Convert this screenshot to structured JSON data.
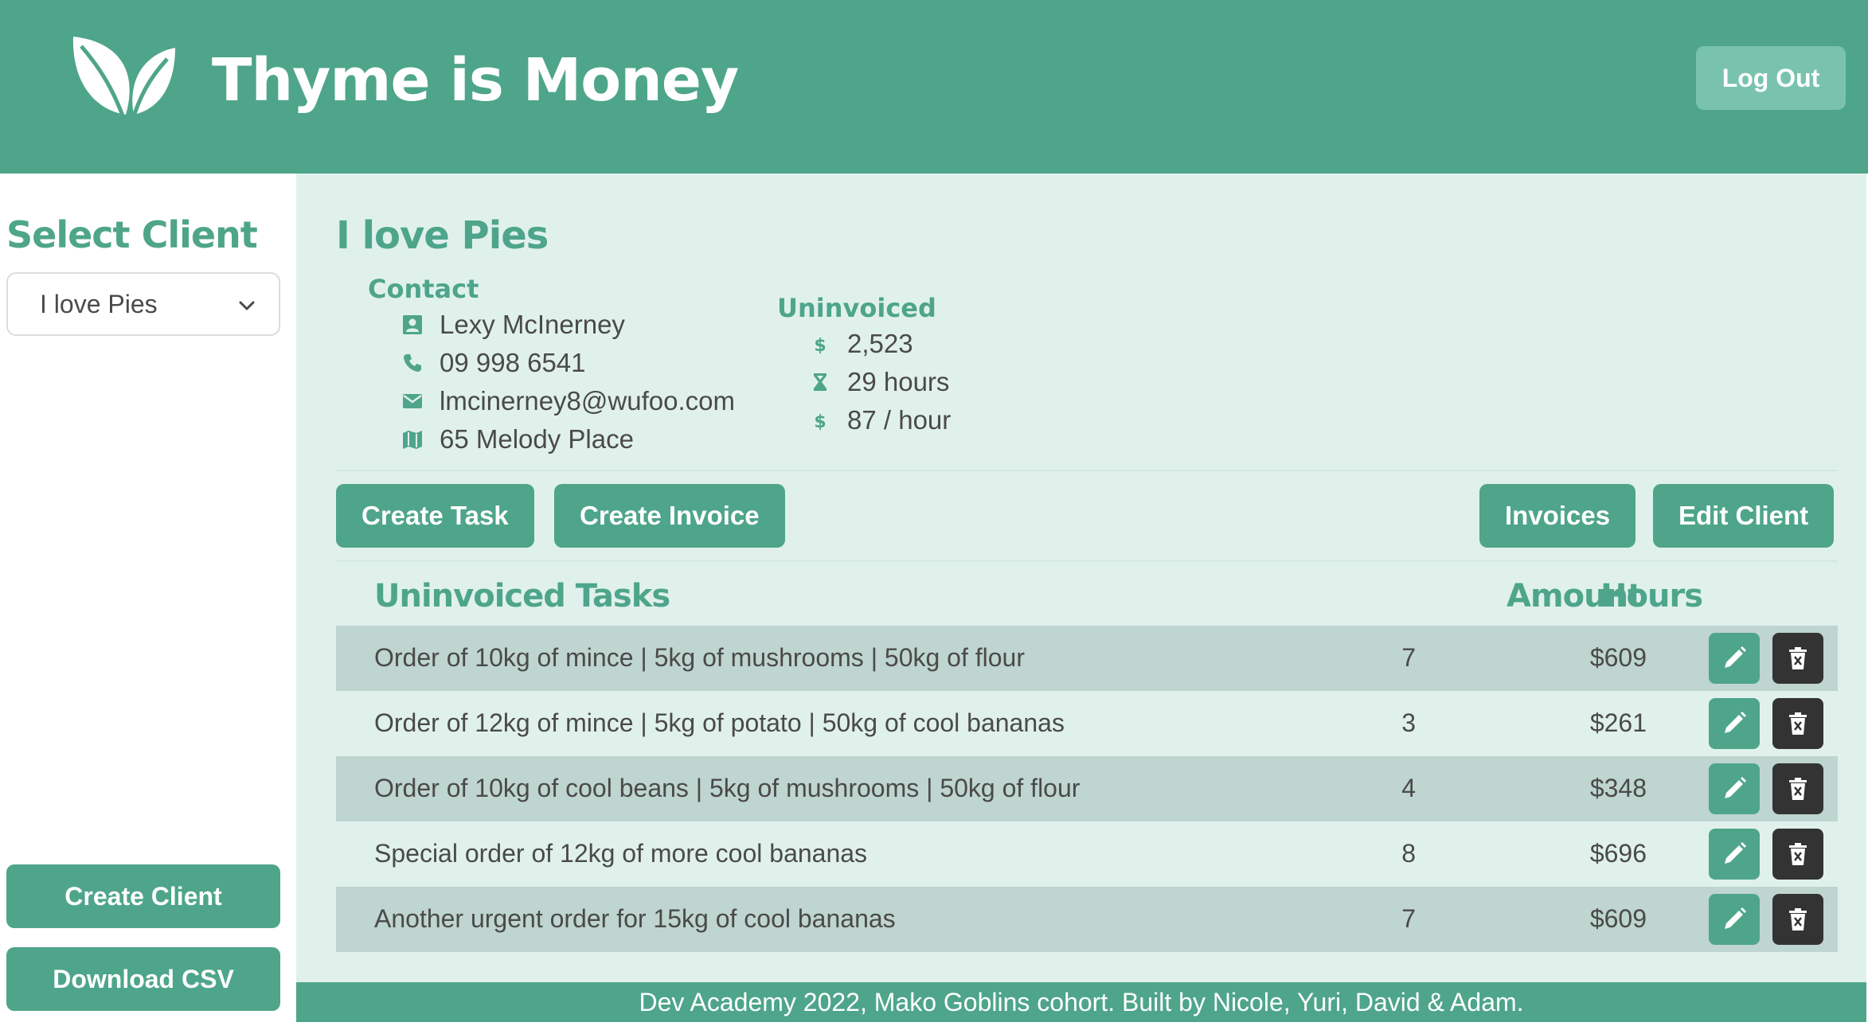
{
  "app": {
    "title": "Thyme is Money",
    "logout_label": "Log Out"
  },
  "colors": {
    "brand": "#4ea58a",
    "brand_light": "#79c3ad",
    "main_bg": "#e0f1ec",
    "row_shade": "#bfd5cf",
    "delete_bg": "#333333"
  },
  "sidebar": {
    "title": "Select Client",
    "selected_client": "I love Pies",
    "create_client_label": "Create Client",
    "download_csv_label": "Download CSV"
  },
  "client": {
    "name": "I love Pies",
    "contact": {
      "label": "Contact",
      "person": "Lexy McInerney",
      "phone": "09 998 6541",
      "email": "lmcinerney8@wufoo.com",
      "address": "65 Melody Place"
    },
    "uninvoiced": {
      "label": "Uninvoiced",
      "amount": "2,523",
      "hours": "29 hours",
      "rate": "87 / hour"
    }
  },
  "actions": {
    "create_task": "Create Task",
    "create_invoice": "Create Invoice",
    "invoices": "Invoices",
    "edit_client": "Edit Client"
  },
  "table": {
    "headers": {
      "task": "Uninvoiced Tasks",
      "hours": "Hours",
      "amount": "Amount"
    },
    "rows": [
      {
        "description": "Order of 10kg of mince | 5kg of mushrooms | 50kg of flour",
        "hours": "7",
        "amount": "$609"
      },
      {
        "description": "Order of 12kg of mince | 5kg of potato | 50kg of cool bananas",
        "hours": "3",
        "amount": "$261"
      },
      {
        "description": "Order of 10kg of cool beans | 5kg of mushrooms | 50kg of flour",
        "hours": "4",
        "amount": "$348"
      },
      {
        "description": "Special order of 12kg of more cool bananas",
        "hours": "8",
        "amount": "$696"
      },
      {
        "description": "Another urgent order for 15kg of cool bananas",
        "hours": "7",
        "amount": "$609"
      }
    ]
  },
  "icons": {
    "logo": "leaf-logo-icon",
    "person": "contact-card-icon",
    "phone": "phone-icon",
    "email": "envelope-icon",
    "address": "map-icon",
    "amount": "dollar-icon",
    "hours": "hourglass-icon",
    "rate": "dollar-icon",
    "edit": "pencil-icon",
    "delete": "trash-icon",
    "select": "chevron-down-icon"
  },
  "footer": {
    "text": "Dev Academy 2022, Mako Goblins cohort. Built by Nicole, Yuri, David & Adam."
  }
}
